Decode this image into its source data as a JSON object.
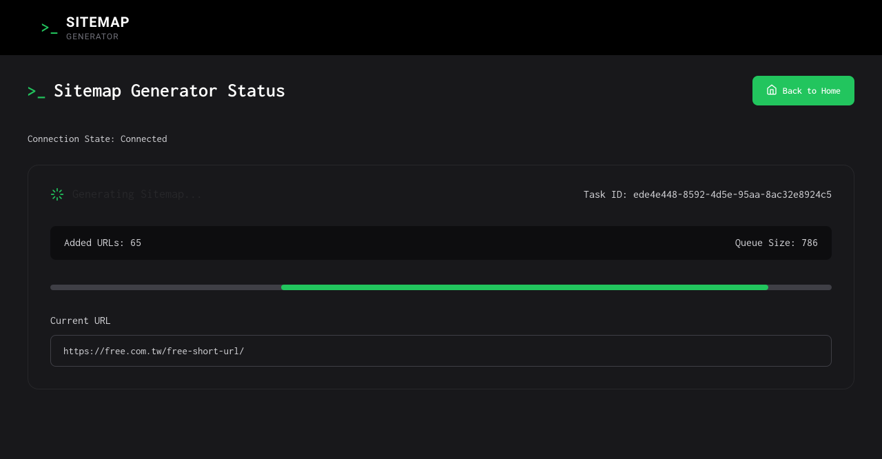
{
  "header": {
    "title": "SITEMAP",
    "subtitle": "GENERATOR"
  },
  "page": {
    "title": "Sitemap Generator Status",
    "homeButton": "Back to Home"
  },
  "connection": {
    "label": "Connection State: ",
    "state": "Connected"
  },
  "status": {
    "generatingText": "Generating Sitemap...",
    "taskIdLabel": "Task ID: ",
    "taskId": "ede4e448-8592-4d5e-95aa-8ac32e8924c5",
    "addedUrlsLabel": "Added URLs: ",
    "addedUrlsValue": "65",
    "queueSizeLabel": "Queue Size: ",
    "queueSizeValue": "786",
    "currentUrlLabel": "Current URL",
    "currentUrl": "https://free.com.tw/free-short-url/"
  },
  "colors": {
    "accent": "#22c55e",
    "background": "#18181b",
    "headerBg": "#000000"
  }
}
